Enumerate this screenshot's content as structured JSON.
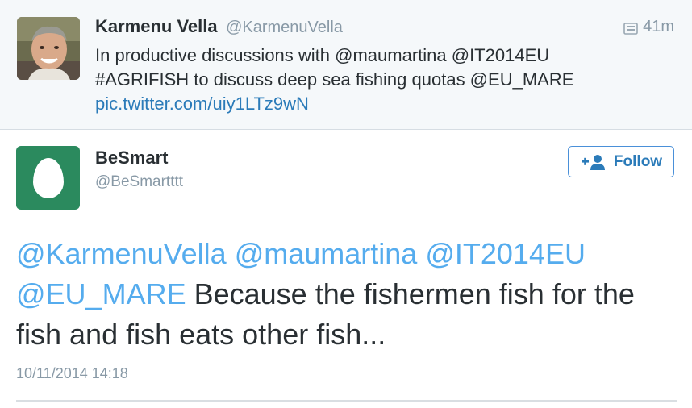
{
  "quoted_tweet": {
    "author_name": "Karmenu Vella",
    "author_handle": "@KarmenuVella",
    "time": "41m",
    "icons": {
      "avatar": "profile-photo",
      "media": "photo-icon"
    },
    "text_line1": "In productive discussions with @maumartina @IT2014EU",
    "text_line2": "#AGRIFISH  to discuss deep sea fishing quotas @EU_MARE",
    "link": "pic.twitter.com/uiy1LTz9wN"
  },
  "tweet": {
    "author_name": "BeSmart",
    "author_handle": "@BeSmartttt",
    "follow_label": "Follow",
    "icons": {
      "avatar": "default-egg-avatar",
      "follow": "add-user-icon"
    },
    "mention_1": "@KarmenuVella",
    "mention_2": "@maumartina",
    "mention_3": "@IT2014EU",
    "mention_4": "@EU_MARE",
    "body_line2_rest": " Because the fishermen fish for the",
    "body_line3": "fish and fish eats other fish...",
    "timestamp": "10/11/2014 14:18"
  },
  "colors": {
    "link": "#2b7bb9",
    "mention": "#55acee",
    "muted": "#8899a6",
    "egg_background": "#2b8a5e",
    "quoted_background": "#f5f8fa"
  }
}
